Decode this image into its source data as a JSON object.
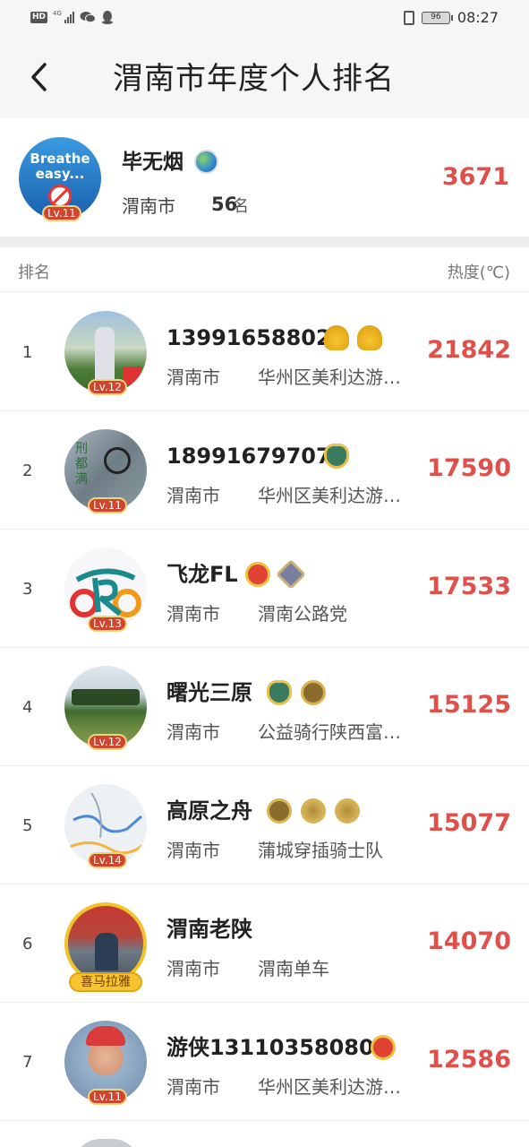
{
  "status_bar": {
    "left_indicators": [
      "HD",
      "4G"
    ],
    "battery": "96",
    "time": "08:27",
    "icons": [
      "hd-icon",
      "signal-icon",
      "wechat-icon",
      "qq-icon",
      "vibrate-icon",
      "battery-icon"
    ]
  },
  "header": {
    "title": "渭南市年度个人排名",
    "back_icon": "chevron-left-icon"
  },
  "me": {
    "name": "毕无烟",
    "avatar_text": [
      "Breathe",
      "easy..."
    ],
    "level": "Lv.11",
    "city": "渭南市",
    "rank": "56",
    "rank_unit": "名",
    "heat": "3671",
    "badge_icon": "globe-icon"
  },
  "columns": {
    "rank": "排名",
    "heat": "热度(℃)"
  },
  "rows": [
    {
      "rank": "1",
      "name": "13991658802",
      "level": "Lv.12",
      "city": "渭南市",
      "team": "华州区美利达游…",
      "heat": "21842",
      "badges": [
        "helmet-badge",
        "helmet-badge"
      ]
    },
    {
      "rank": "2",
      "name": "18991679707",
      "level": "Lv.11",
      "city": "渭南市",
      "team": "华州区美利达游…",
      "heat": "17590",
      "badges": [
        "shield-badge"
      ]
    },
    {
      "rank": "3",
      "name": "飞龙FL",
      "level": "Lv.13",
      "city": "渭南市",
      "team": "渭南公路党",
      "heat": "17533",
      "badges": [
        "red-medal-badge",
        "star-badge"
      ]
    },
    {
      "rank": "4",
      "name": "曙光三原",
      "level": "Lv.12",
      "city": "渭南市",
      "team": "公益骑行陕西富…",
      "heat": "15125",
      "badges": [
        "shield-badge",
        "dark-medal-badge"
      ]
    },
    {
      "rank": "5",
      "name": "高原之舟",
      "level": "Lv.14",
      "city": "渭南市",
      "team": "蒲城穿插骑士队",
      "heat": "15077",
      "badges": [
        "dark-medal-badge",
        "sun-badge",
        "sun-badge"
      ]
    },
    {
      "rank": "6",
      "name": "渭南老陕",
      "level": "喜马拉雅",
      "city": "渭南市",
      "team": "渭南单车",
      "heat": "14070",
      "badges": []
    },
    {
      "rank": "7",
      "name": "游侠13110358080",
      "level": "Lv.11",
      "city": "渭南市",
      "team": "华州区美利达游…",
      "heat": "12586",
      "badges": [
        "red-medal-badge"
      ]
    }
  ]
}
